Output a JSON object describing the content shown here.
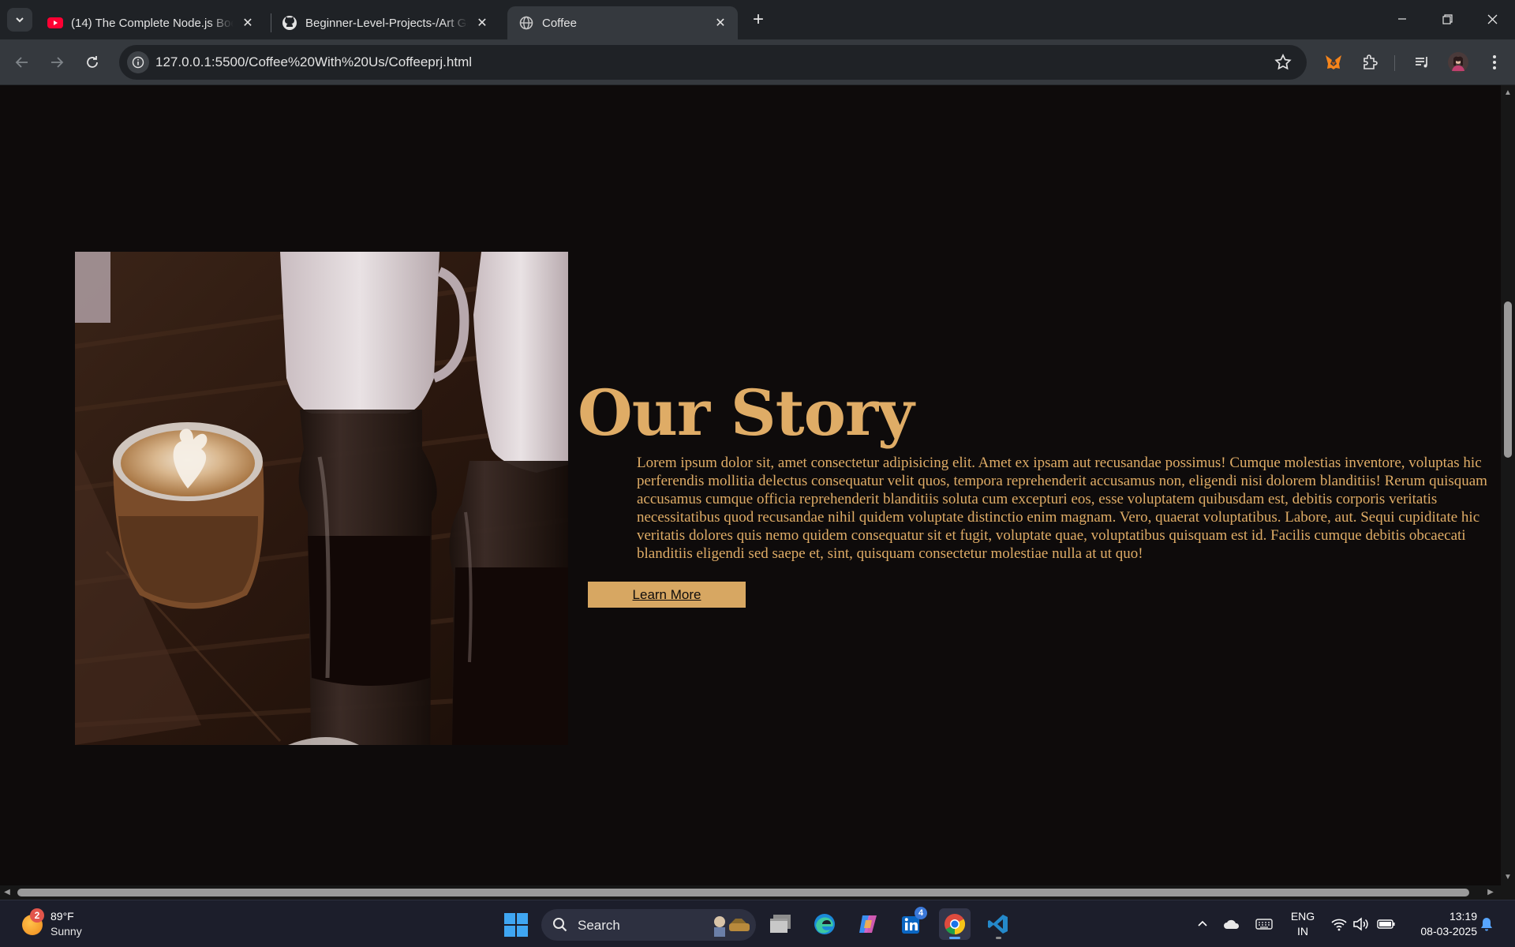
{
  "browser": {
    "tabs": [
      {
        "title": "(14) The Complete Node.js Boot",
        "icon": "youtube-icon",
        "active": false
      },
      {
        "title": "Beginner-Level-Projects-/Art Ga",
        "icon": "github-icon",
        "active": false
      },
      {
        "title": "Coffee",
        "icon": "globe-icon",
        "active": true
      }
    ],
    "url": "127.0.0.1:5500/Coffee%20With%20Us/Coffeeprj.html"
  },
  "page": {
    "heading": "Our Story",
    "body": "Lorem ipsum dolor sit, amet consectetur adipisicing elit. Amet ex ipsam aut recusandae possimus! Cumque molestias inventore, voluptas hic perferendis mollitia delectus consequatur velit quos, tempora reprehenderit accusamus non, eligendi nisi dolorem blanditiis! Rerum quisquam accusamus cumque officia reprehenderit blanditiis soluta cum excepturi eos, esse voluptatem quibusdam est, debitis corporis veritatis necessitatibus quod recusandae nihil quidem voluptate distinctio enim magnam. Vero, quaerat voluptatibus. Labore, aut. Sequi cupiditate hic veritatis dolores quis nemo quidem consequatur sit et fugit, voluptate quae, voluptatibus quisquam est id. Facilis cumque debitis obcaecati blanditiis eligendi sed saepe et, sint, quisquam consectetur molestiae nulla at ut quo!",
    "button_label": "Learn More",
    "image_description": "coffee-photo",
    "accent_color": "#dfac66"
  },
  "taskbar": {
    "weather": {
      "temp": "89°F",
      "condition": "Sunny",
      "badge": "2"
    },
    "search_label": "Search",
    "linkedin_badge": "4",
    "language": [
      "ENG",
      "IN"
    ],
    "time": "13:19",
    "date": "08-03-2025"
  }
}
